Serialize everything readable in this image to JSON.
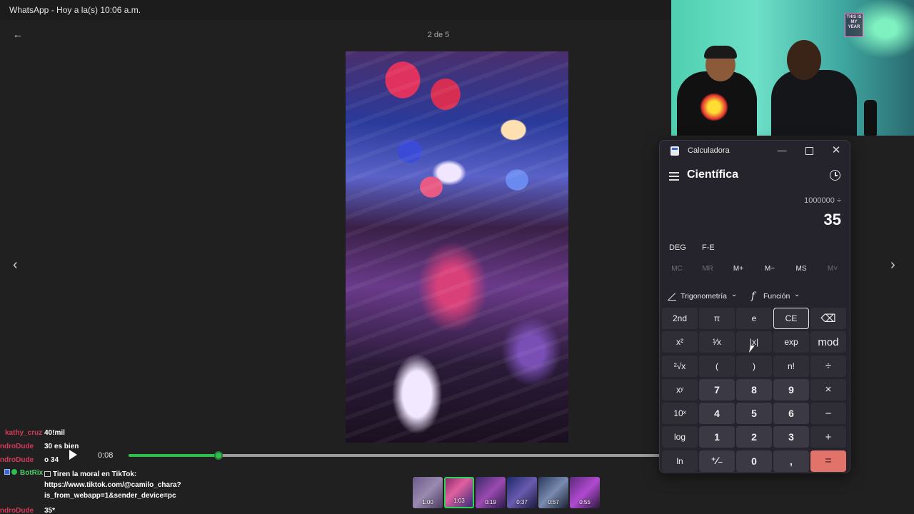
{
  "whatsapp": {
    "window_title": "WhatsApp - Hoy a la(s) 10:06 a.m.",
    "counter": "2 de 5",
    "back_icon": "arrow-left-icon",
    "prev_icon": "chevron-left-icon",
    "next_icon": "chevron-right-icon",
    "player": {
      "current_time": "0:08",
      "progress_fraction": 0.17,
      "accent_color": "#2fbf4f"
    },
    "thumbnails": [
      {
        "duration": "1:00",
        "active": false
      },
      {
        "duration": "1:03",
        "active": true
      },
      {
        "duration": "0:19",
        "active": false
      },
      {
        "duration": "0:37",
        "active": false
      },
      {
        "duration": "0:57",
        "active": false
      },
      {
        "duration": "0:55",
        "active": false
      }
    ]
  },
  "chat": {
    "messages": [
      {
        "user": "kathy_cruz",
        "text": "40!mil"
      },
      {
        "user": "ejandroDude",
        "text": "30 es bien"
      },
      {
        "user": "ejandroDude",
        "text": "o 34"
      }
    ],
    "bot": {
      "user": "BotRix",
      "lines": [
        "Tiren la moral en TikTok:",
        "https://www.tiktok.com/@camilo_chara?",
        "is_from_webapp=1&sender_device=pc"
      ]
    },
    "last": {
      "user": "ejandroDude",
      "text": "35*"
    }
  },
  "webcam": {
    "sign_text": "THIS IS MY YEAR"
  },
  "calculator": {
    "app_title": "Calculadora",
    "mode": "Científica",
    "expression": "1000000 ÷",
    "display": "35",
    "angle_mode": "DEG",
    "fe_label": "F-E",
    "memory": [
      {
        "label": "MC",
        "enabled": false
      },
      {
        "label": "MR",
        "enabled": false
      },
      {
        "label": "M+",
        "enabled": true
      },
      {
        "label": "M−",
        "enabled": true
      },
      {
        "label": "MS",
        "enabled": true
      },
      {
        "label": "M˅",
        "enabled": false
      }
    ],
    "trig_label": "Trigonometría",
    "func_label": "Función",
    "keys": [
      [
        "2nd",
        "π",
        "e",
        "CE",
        "⌫"
      ],
      [
        "x²",
        "¹⁄x",
        "|x|",
        "exp",
        "mod"
      ],
      [
        "²√x",
        "(",
        ")",
        "n!",
        "÷"
      ],
      [
        "xʸ",
        "7",
        "8",
        "9",
        "×"
      ],
      [
        "10ˣ",
        "4",
        "5",
        "6",
        "−"
      ],
      [
        "log",
        "1",
        "2",
        "3",
        "+"
      ],
      [
        "ln",
        "⁺⁄₋",
        "0",
        ",",
        "="
      ]
    ],
    "equals_color": "#e2736a"
  }
}
